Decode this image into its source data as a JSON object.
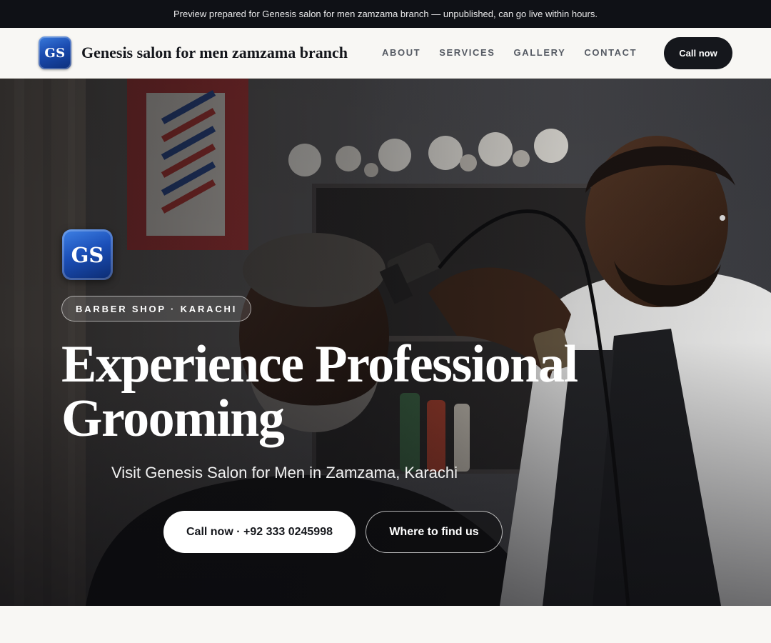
{
  "preview_banner": "Preview prepared for Genesis salon for men zamzama branch — unpublished, can go live within hours.",
  "header": {
    "logo_initials": "GS",
    "brand_name": "Genesis salon for men zamzama branch",
    "nav": [
      "ABOUT",
      "SERVICES",
      "GALLERY",
      "CONTACT"
    ],
    "cta_label": "Call now"
  },
  "hero": {
    "logo_initials": "GS",
    "tagline": "BARBER SHOP · KARACHI",
    "title": "Experience Professional Grooming",
    "subtitle": "Visit Genesis Salon for Men in Zamzama, Karachi",
    "primary_button": "Call now · +92 333 0245998",
    "secondary_button": "Where to find us"
  },
  "colors": {
    "dark": "#15171c",
    "banner_bg": "#0f1116",
    "page_bg": "#f8f7f4",
    "logo_blue": "#1a4bb0"
  }
}
